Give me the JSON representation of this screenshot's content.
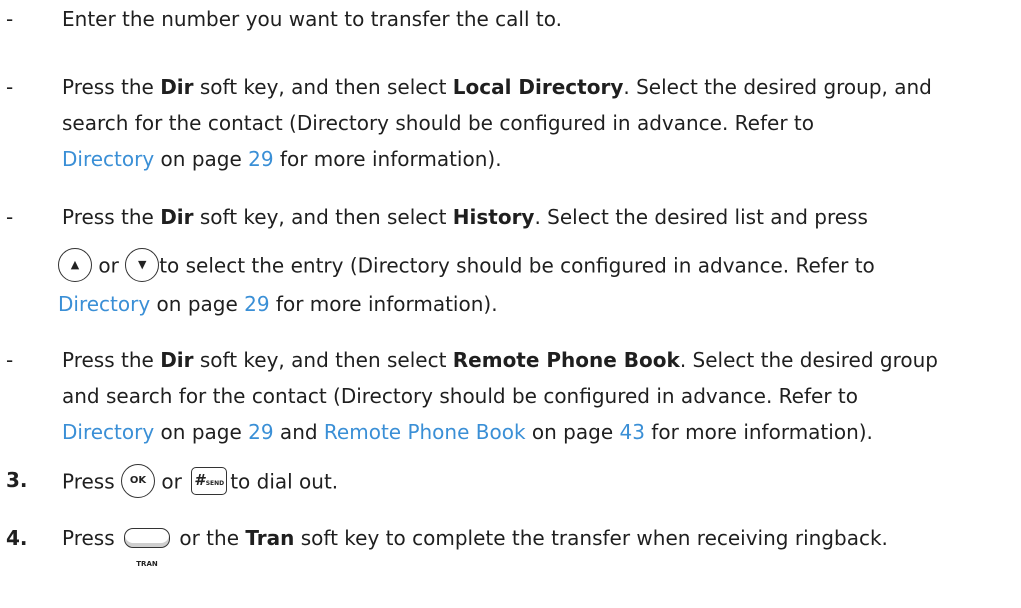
{
  "items": [
    {
      "marker": "-",
      "lines": [
        {
          "text": "Enter the number you want to transfer the call to."
        }
      ]
    },
    {
      "marker": "-",
      "lines": [
        {
          "a": "Press the ",
          "b": "Dir",
          "c": " soft key, and then select ",
          "d": "Local Directory",
          "e": ". Select the desired group, and"
        },
        {
          "text": "search for the contact (Directory should be configured in advance. Refer to"
        },
        {
          "link": "Directory",
          "mid": " on page ",
          "page": "29",
          "end": " for more information)."
        }
      ]
    },
    {
      "marker": "-",
      "lines": [
        {
          "a": "Press the ",
          "b": "Dir",
          "c": " soft key, and then select ",
          "d": "History",
          "e": ". Select the desired list and press"
        },
        {
          "or": " or ",
          "rest": "to select the entry (Directory should be configured in advance. Refer to"
        },
        {
          "link": "Directory",
          "mid": " on page ",
          "page": "29",
          "end": " for more information)."
        }
      ]
    },
    {
      "marker": "-",
      "lines": [
        {
          "a": "Press the ",
          "b": "Dir",
          "c": " soft key, and then select ",
          "d": "Remote Phone Book",
          "e": ". Select the desired group"
        },
        {
          "text": "and search for the contact (Directory should be configured in advance. Refer to"
        },
        {
          "link": "Directory",
          "mid": " on page ",
          "page": "29",
          "and": " and ",
          "link2": "Remote Phone Book",
          "mid2": " on page ",
          "page2": "43",
          "end": " for more information)."
        }
      ]
    }
  ],
  "steps": [
    {
      "num": "3.",
      "press": "Press ",
      "or": " or ",
      "rest": "to dial out."
    },
    {
      "num": "4.",
      "press": "Press ",
      "mid": " or the ",
      "bold": "Tran",
      "rest": " soft key to complete the transfer when receiving ringback."
    }
  ],
  "keys": {
    "up": "▲",
    "down": "▼",
    "ok": "OK",
    "hash": "#",
    "hash_sub": "SEND",
    "tran": "TRAN"
  },
  "colors": {
    "link": "#3a8fd6",
    "text": "#1f1f1f"
  }
}
